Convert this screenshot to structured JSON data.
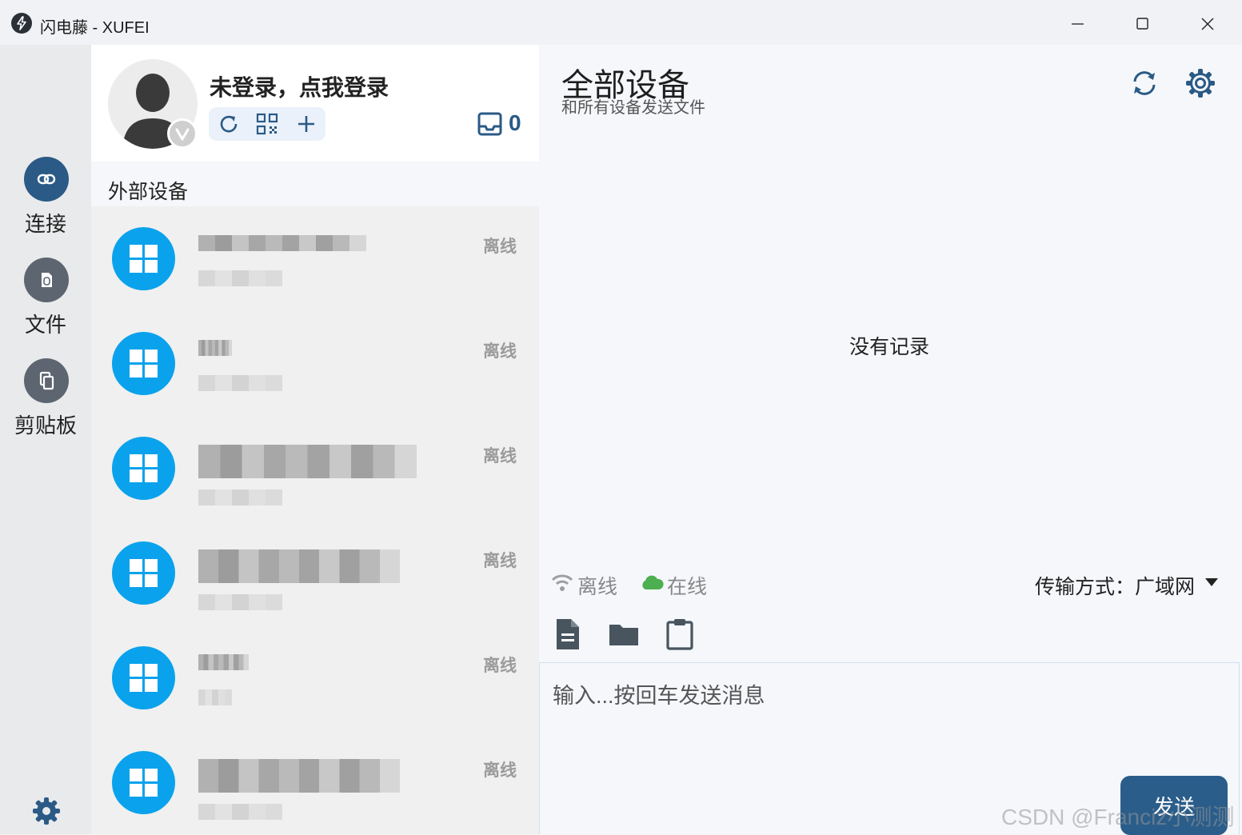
{
  "window": {
    "title": "闪电藤 - XUFEI",
    "logo_icon": "lightning-bolt-icon",
    "controls": [
      "minimize-icon",
      "maximize-icon",
      "close-icon"
    ]
  },
  "nav": {
    "items": [
      {
        "label": "连接",
        "icon": "link-icon",
        "active": true,
        "color": "#2a5a85"
      },
      {
        "label": "文件",
        "icon": "file-icon",
        "active": false,
        "color": "#5d6670"
      },
      {
        "label": "剪贴板",
        "icon": "clipboard-copy-icon",
        "active": false,
        "color": "#5d6670"
      }
    ],
    "settings_icon": "gear-icon"
  },
  "user": {
    "login_text": "未登录，点我登录",
    "avatar_icon": "person-avatar-icon",
    "badge_icon": "vip-badge-icon",
    "actions": [
      "refresh-icon",
      "qr-code-icon",
      "plus-icon"
    ],
    "inbox_icon": "inbox-icon",
    "inbox_count": "0"
  },
  "device_list": {
    "section_title": "外部设备",
    "items": [
      {
        "status": "离线",
        "icon": "windows-icon"
      },
      {
        "status": "离线",
        "icon": "windows-icon"
      },
      {
        "status": "离线",
        "icon": "windows-icon"
      },
      {
        "status": "离线",
        "icon": "windows-icon"
      },
      {
        "status": "离线",
        "icon": "windows-icon"
      },
      {
        "status": "离线",
        "icon": "windows-icon"
      }
    ]
  },
  "main": {
    "title": "全部设备",
    "subtitle": "和所有设备发送文件",
    "empty_text": "没有记录",
    "legend": [
      {
        "label": "离线",
        "icon": "wifi-icon",
        "color": "#9e9e9e"
      },
      {
        "label": "在线",
        "icon": "cloud-icon",
        "color": "#4caf50"
      }
    ],
    "transfer_mode": "传输方式：广域网",
    "tools": [
      "document-icon",
      "folder-icon",
      "clipboard-icon"
    ],
    "input_placeholder": "输入...按回车发送消息",
    "send_label": "发送"
  },
  "watermark": "CSDN @Franciz小测测",
  "colors": {
    "accent": "#2a5a85",
    "device_icon": "#0aa2ec",
    "online": "#4caf50"
  }
}
